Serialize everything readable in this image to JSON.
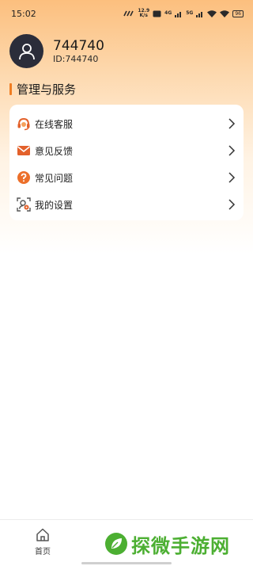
{
  "status_bar": {
    "time": "15:02",
    "speed_value": "12.9",
    "speed_unit": "K/s",
    "net_a": "4G",
    "net_b": "5G",
    "battery": "96"
  },
  "profile": {
    "name": "744740",
    "id_label": "ID:744740"
  },
  "section": {
    "title": "管理与服务"
  },
  "menu": {
    "items": [
      {
        "label": "在线客服",
        "icon": "headset-icon"
      },
      {
        "label": "意见反馈",
        "icon": "mail-icon"
      },
      {
        "label": "常见问题",
        "icon": "question-icon"
      },
      {
        "label": "我的设置",
        "icon": "settings-icon"
      }
    ]
  },
  "tabbar": {
    "home_label": "首页"
  },
  "watermark": {
    "text": "探微手游网"
  },
  "colors": {
    "accent": "#f07d22",
    "header_gradient_top": "#fcbf7e",
    "avatar_bg": "#2b2d3a",
    "watermark_green": "#4caf32"
  }
}
